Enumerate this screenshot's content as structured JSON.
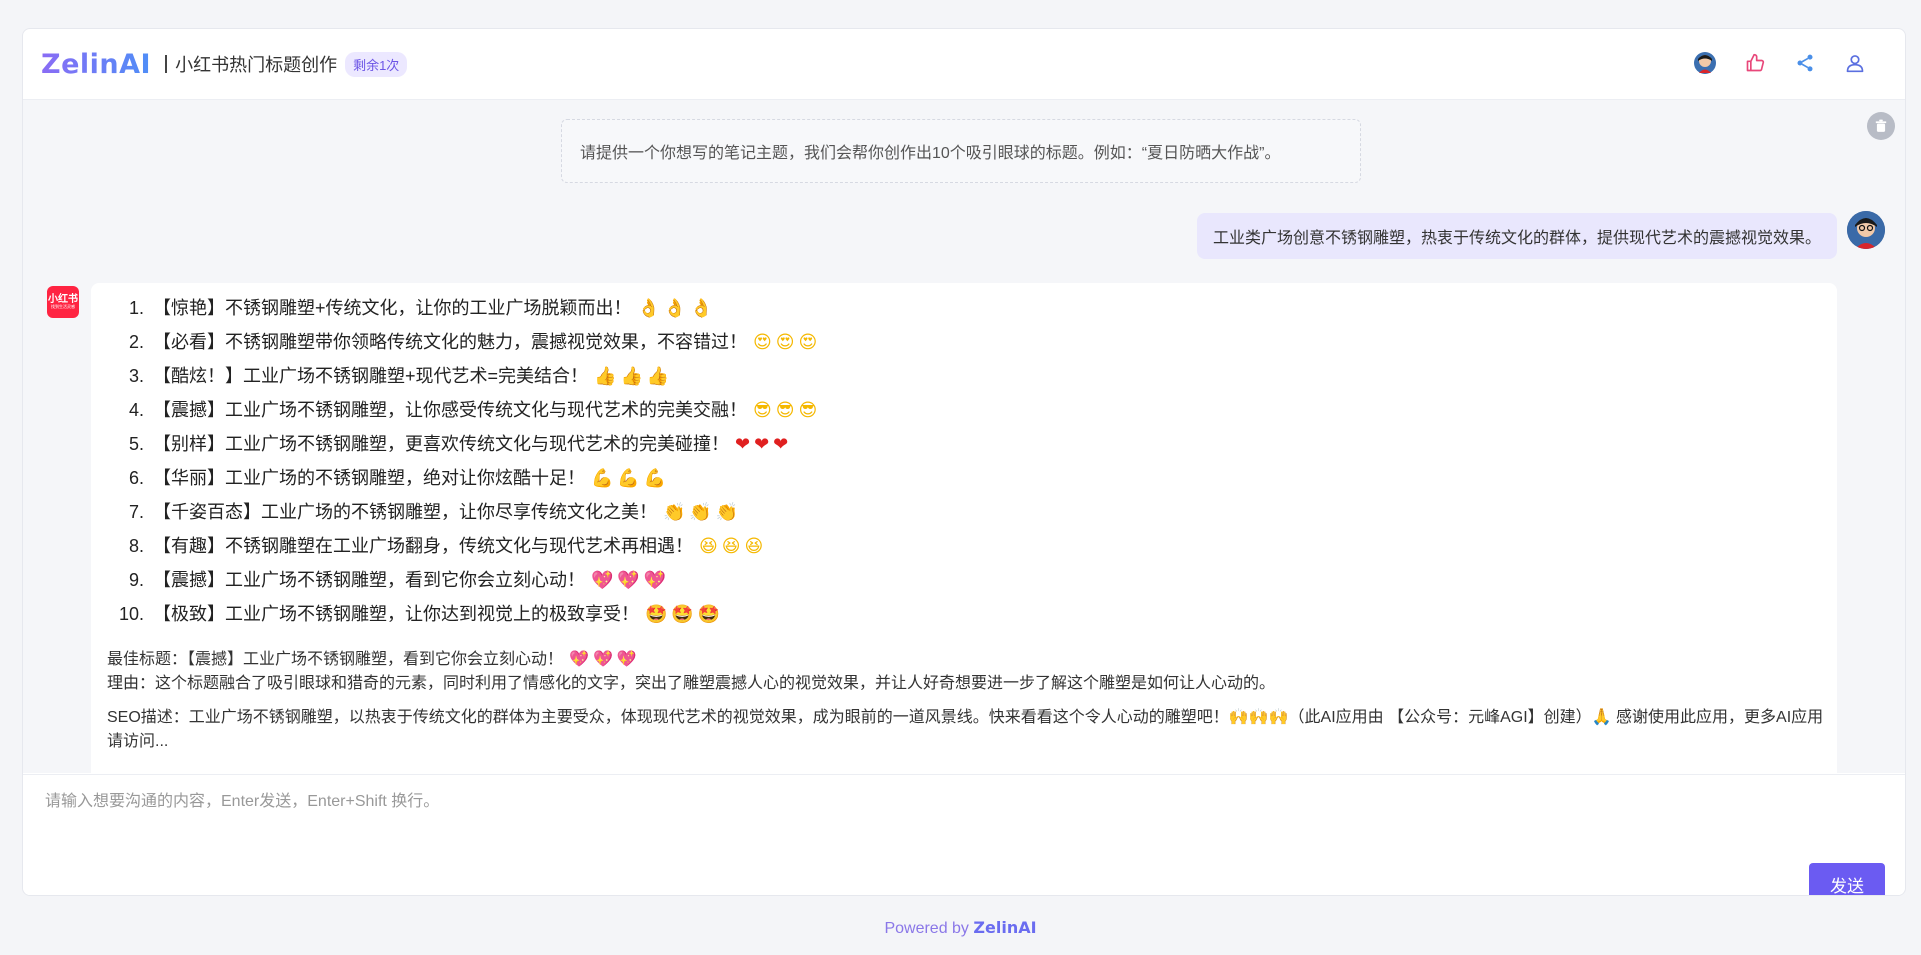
{
  "header": {
    "logo": "ZelinAI",
    "title": "小红书热门标题创作",
    "badge": "剩余1次",
    "icons": [
      "avatar",
      "thumbs-up-icon",
      "share-icon",
      "user-icon"
    ]
  },
  "chat": {
    "hint": "请提供一个你想写的笔记主题，我们会帮你创作出10个吸引眼球的标题。例如：“夏日防晒大作战”。",
    "user_message": "工业类广场创意不锈钢雕塑，热衷于传统文化的群体，提供现代艺术的震撼视觉效果。",
    "bot_avatar": [
      "小红书",
      "找到生活灵感"
    ],
    "titles": [
      {
        "text": "【惊艳】不锈钢雕塑+传统文化，让你的工业广场脱颖而出！",
        "emoji": "👌👌👌",
        "tone": "gold"
      },
      {
        "text": "【必看】不锈钢雕塑带你领略传统文化的魅力，震撼视觉效果，不容错过！",
        "emoji": "😍😍😍",
        "tone": "gold"
      },
      {
        "text": "【酷炫！】工业广场不锈钢雕塑+现代艺术=完美结合！",
        "emoji": "👍👍👍",
        "tone": "gold"
      },
      {
        "text": "【震撼】工业广场不锈钢雕塑，让你感受传统文化与现代艺术的完美交融！",
        "emoji": "😎😎😎",
        "tone": "gold"
      },
      {
        "text": "【别样】工业广场不锈钢雕塑，更喜欢传统文化与现代艺术的完美碰撞！",
        "emoji": "❤❤❤",
        "tone": "red"
      },
      {
        "text": "【华丽】工业广场的不锈钢雕塑，绝对让你炫酷十足！",
        "emoji": "💪💪💪",
        "tone": "gold"
      },
      {
        "text": "【千姿百态】工业广场的不锈钢雕塑，让你尽享传统文化之美！",
        "emoji": "👏👏👏",
        "tone": "gold"
      },
      {
        "text": "【有趣】不锈钢雕塑在工业广场翻身，传统文化与现代艺术再相遇！",
        "emoji": "😆😆😆",
        "tone": "gold"
      },
      {
        "text": "【震撼】工业广场不锈钢雕塑，看到它你会立刻心动！",
        "emoji": "💖💖💖",
        "tone": "pink"
      },
      {
        "text": "【极致】工业广场不锈钢雕塑，让你达到视觉上的极致享受！",
        "emoji": "🤩🤩🤩",
        "tone": "gold"
      }
    ],
    "best_title": "最佳标题：【震撼】工业广场不锈钢雕塑，看到它你会立刻心动！",
    "best_emoji": "💖💖💖",
    "reason": "理由：这个标题融合了吸引眼球和猎奇的元素，同时利用了情感化的文字，突出了雕塑震撼人心的视觉效果，并让人好奇想要进一步了解这个雕塑是如何让人心动的。",
    "seo": "SEO描述：工业广场不锈钢雕塑，以热衷于传统文化的群体为主要受众，体现现代艺术的视觉效果，成为眼前的一道风景线。快来看看这个令人心动的雕塑吧！🙌🙌🙌（此AI应用由 【公众号：元峰AGI】创建）🙏 感谢使用此应用，更多AI应用请访问..."
  },
  "input": {
    "placeholder": "请输入想要沟通的内容，Enter发送，Enter+Shift 换行。",
    "send_label": "发送"
  },
  "footer": {
    "powered_by": "Powered by",
    "brand": "ZelinAI"
  },
  "colors": {
    "accent": "#6b5bf2",
    "user_bubble": "#e9e7fd",
    "brand_red": "#ff2442"
  }
}
